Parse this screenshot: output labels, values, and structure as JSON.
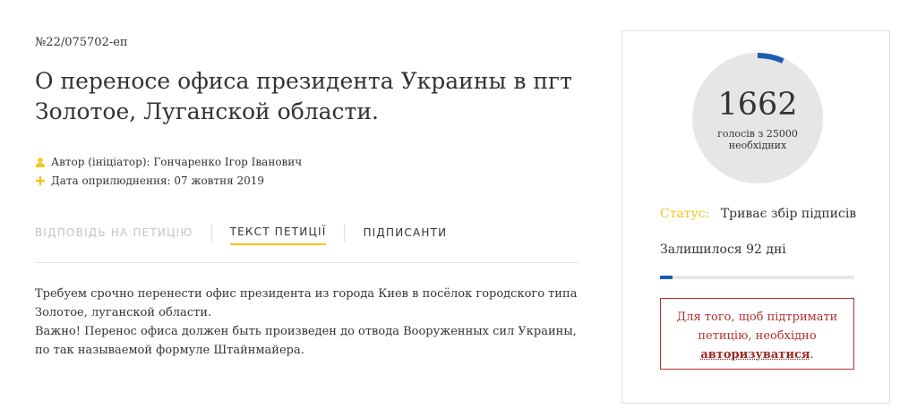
{
  "petition": {
    "number": "№22/075702-еп",
    "title": "О переносе офиса президента Украины в пгт Золотое, Луганской области.",
    "author": "Автор (ініціатор): Гончаренко Ігор Іванович",
    "date": "Дата оприлюднення: 07 жовтня 2019"
  },
  "tabs": [
    {
      "label": "ВІДПОВІДЬ НА ПЕТИЦІЮ"
    },
    {
      "label": "ТЕКСТ ПЕТИЦІЇ"
    },
    {
      "label": "ПІДПИСАНТИ"
    }
  ],
  "body": {
    "line1": "Требуем срочно перенести офис президента из города Киев в посёлок городского типа Золотое, луганской области.",
    "line2": "Важно! Перенос офиса должен быть произведен до отвода Вооруженных сил Украины, по так называемой формуле Штайнмайера."
  },
  "card": {
    "votes": "1662",
    "votes_caption_1": "голосів з 25000",
    "votes_caption_2": "необхідних",
    "votes_required": 25000,
    "votes_current": 1662,
    "status_label": "Статус:",
    "status_value": "Триває збір підписів",
    "remaining": "Залишилося 92 дні",
    "auth_text_1": "Для того, щоб підтримати петицію, необхідно ",
    "auth_link": "авторизуватися",
    "auth_text_2": "."
  },
  "colors": {
    "accent_yellow": "#f5c518",
    "progress_blue": "#1a5eb0",
    "alert_red": "#b3312e",
    "circle_grey": "#e6e6e6"
  },
  "icons": {
    "author": "person-icon",
    "date": "plus-icon"
  }
}
